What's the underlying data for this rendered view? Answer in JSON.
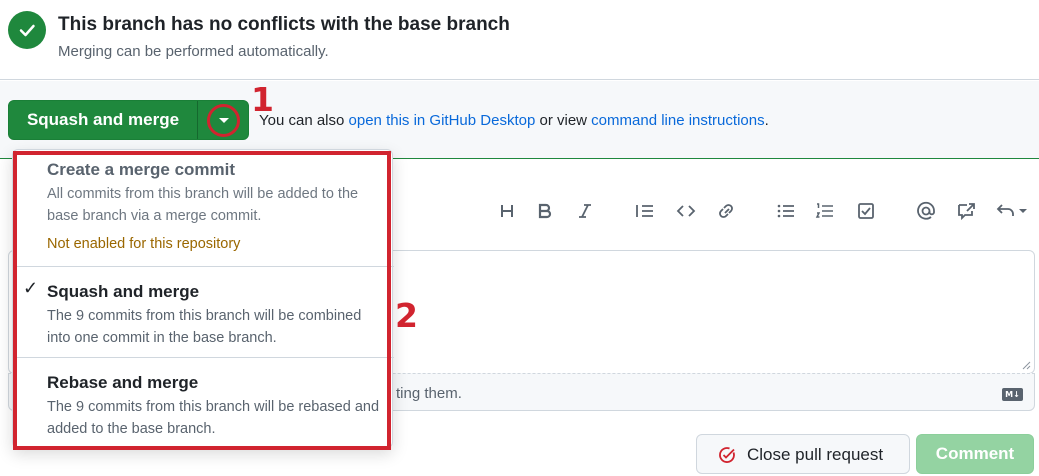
{
  "status": {
    "title": "This branch has no conflicts with the base branch",
    "subtitle": "Merging can be performed automatically."
  },
  "merge": {
    "button_label": "Squash and merge",
    "also_prefix": "You can also ",
    "desktop_link": "open this in GitHub Desktop",
    "or_view": " or view ",
    "cli_link": "command line instructions",
    "suffix": "."
  },
  "annotations": {
    "one": "1",
    "two": "2"
  },
  "dropdown": {
    "items": [
      {
        "title": "Create a merge commit",
        "description": "All commits from this branch will be added to the base branch via a merge commit.",
        "note": "Not enabled for this repository",
        "selected": false,
        "disabled": true
      },
      {
        "title": "Squash and merge",
        "description": "The 9 commits from this branch will be combined into one commit in the base branch.",
        "selected": true,
        "disabled": false
      },
      {
        "title": "Rebase and merge",
        "description": "The 9 commits from this branch will be rebased and added to the base branch.",
        "selected": false,
        "disabled": false
      }
    ]
  },
  "editor": {
    "toolbar_icons": [
      "heading-icon",
      "bold-icon",
      "italic-icon",
      "quote-icon",
      "code-icon",
      "link-icon",
      "unordered-list-icon",
      "ordered-list-icon",
      "task-list-icon",
      "mention-icon",
      "cross-reference-icon",
      "saved-replies-icon"
    ],
    "attach_text": "ting them.",
    "markdown_badge": "M↓"
  },
  "actions": {
    "close_label": "Close pull request",
    "comment_label": "Comment"
  },
  "colors": {
    "success": "#1f883d",
    "link": "#0969da",
    "annotation": "#d1242f",
    "warning": "#9a6700"
  }
}
